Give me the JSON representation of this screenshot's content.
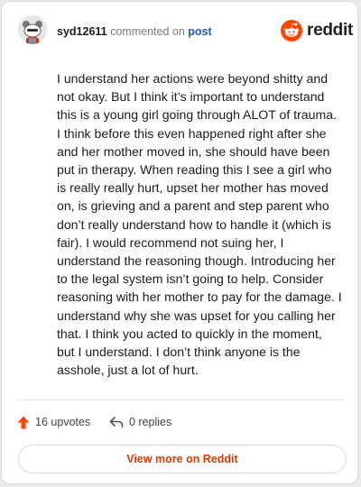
{
  "header": {
    "username": "syd12611",
    "action_text": "commented on",
    "post_link": "post"
  },
  "brand": {
    "wordmark": "reddit",
    "logo_icon": "reddit-snoo-icon",
    "logo_color": "#ff4500"
  },
  "comment": {
    "body": "I understand her actions were beyond shitty and not okay. But I think it’s important to understand this is a young girl going through ALOT of trauma. I think before this even happened right after she and her mother moved in, she should have been put in therapy. When reading this I see a girl who is really really hurt, upset her mother has moved on, is grieving and a parent and step parent who don’t really understand how to handle it (which is fair). I would recommend not suing her, I understand the reasoning though. Introducing her to the legal system isn’t going to help. Consider reasoning with her mother to pay for the damage. I understand why she was upset for you calling her that. I think you acted to quickly in the moment, but I understand. I don’t think anyone is the asshole, just a lot of hurt."
  },
  "stats": {
    "upvotes": "16 upvotes",
    "upvote_icon": "upvote-arrow-icon",
    "upvote_color": "#ff4500",
    "replies": "0 replies",
    "reply_icon": "reply-arrow-icon"
  },
  "footer": {
    "view_button": "View more on Reddit",
    "button_color": "#d93a00"
  }
}
